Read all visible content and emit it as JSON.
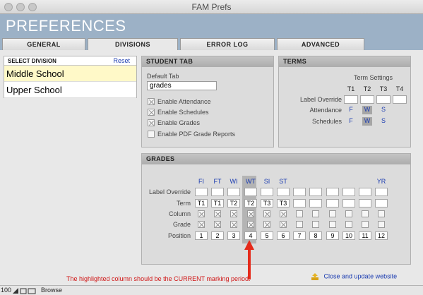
{
  "window": {
    "title": "FAM Prefs"
  },
  "header": {
    "title": "PREFERENCES"
  },
  "tabs": [
    {
      "label": "GENERAL"
    },
    {
      "label": "DIVISIONS"
    },
    {
      "label": "ERROR LOG"
    },
    {
      "label": "ADVANCED"
    }
  ],
  "division": {
    "heading": "SELECT DIVISION",
    "reset": "Reset",
    "items": [
      "Middle School",
      "Upper School"
    ]
  },
  "student_tab": {
    "title": "STUDENT TAB",
    "default_tab_label": "Default Tab",
    "default_tab_value": "grades",
    "options": [
      {
        "label": "Enable Attendance",
        "checked": true
      },
      {
        "label": "Enable Schedules",
        "checked": true
      },
      {
        "label": "Enable Grades",
        "checked": true
      },
      {
        "label": "Enable PDF Grade Reports",
        "checked": false
      }
    ]
  },
  "terms": {
    "title": "TERMS",
    "settings_label": "Term Settings",
    "columns": [
      "T1",
      "T2",
      "T3",
      "T4"
    ],
    "rows": {
      "label_override": "Label Override",
      "attendance": "Attendance",
      "schedules": "Schedules"
    },
    "attendance_values": [
      "F",
      "W",
      "S"
    ],
    "schedule_values": [
      "F",
      "W",
      "S"
    ]
  },
  "grades": {
    "title": "GRADES",
    "row_labels": {
      "label_override": "Label Override",
      "term": "Term",
      "column": "Column",
      "grade": "Grade",
      "position": "Position"
    },
    "headers": [
      "FI",
      "FT",
      "WI",
      "WT",
      "SI",
      "ST",
      "",
      "",
      "",
      "",
      "",
      "YR"
    ],
    "terms": [
      "T1",
      "T1",
      "T2",
      "T2",
      "T3",
      "T3",
      "",
      "",
      "",
      "",
      "",
      ""
    ],
    "column_checked": [
      true,
      true,
      true,
      true,
      true,
      true,
      false,
      false,
      false,
      false,
      false,
      false
    ],
    "grade_checked": [
      true,
      true,
      true,
      true,
      true,
      true,
      false,
      false,
      false,
      false,
      false,
      false
    ],
    "positions": [
      "1",
      "2",
      "3",
      "4",
      "5",
      "6",
      "7",
      "8",
      "9",
      "10",
      "11",
      "12"
    ],
    "highlighted_index": 3
  },
  "note": "The highlighted column  should be the CURRENT marking period.",
  "close_button": "Close and update website",
  "status": {
    "zoom": "100",
    "mode": "Browse"
  },
  "colors": {
    "accent": "#9cb1c6",
    "link": "#1a3bb0",
    "note": "#d01515",
    "selected_row": "#fff9c8"
  }
}
